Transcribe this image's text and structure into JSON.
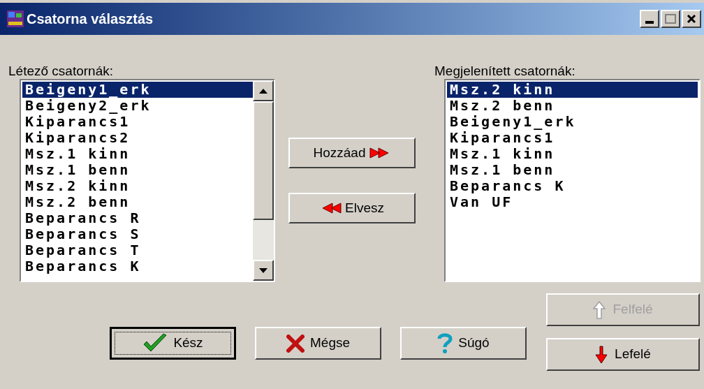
{
  "window": {
    "title": "Csatorna választás"
  },
  "available": {
    "label": "Létező csatornák:",
    "items": [
      {
        "text": "Beigeny1_erk",
        "selected": true
      },
      {
        "text": "Beigeny2_erk",
        "selected": false
      },
      {
        "text": "Kiparancs1",
        "selected": false
      },
      {
        "text": "Kiparancs2",
        "selected": false
      },
      {
        "text": "Msz.1 kinn",
        "selected": false
      },
      {
        "text": "Msz.1 benn",
        "selected": false
      },
      {
        "text": "Msz.2 kinn",
        "selected": false
      },
      {
        "text": "Msz.2 benn",
        "selected": false
      },
      {
        "text": "Beparancs R",
        "selected": false
      },
      {
        "text": "Beparancs S",
        "selected": false
      },
      {
        "text": "Beparancs T",
        "selected": false
      },
      {
        "text": "Beparancs K",
        "selected": false
      }
    ]
  },
  "displayed": {
    "label": "Megjelenített csatornák:",
    "items": [
      {
        "text": "Msz.2 kinn",
        "selected": true
      },
      {
        "text": "Msz.2 benn",
        "selected": false
      },
      {
        "text": "Beigeny1_erk",
        "selected": false
      },
      {
        "text": "Kiparancs1",
        "selected": false
      },
      {
        "text": "Msz.1 kinn",
        "selected": false
      },
      {
        "text": "Msz.1 benn",
        "selected": false
      },
      {
        "text": "Beparancs K",
        "selected": false
      },
      {
        "text": "Van UF",
        "selected": false
      }
    ]
  },
  "add_button": {
    "label": "Hozzáad"
  },
  "remove_button": {
    "label": "Elvesz"
  },
  "buttons": [
    {
      "kind": "ok",
      "label": "Kész",
      "default": true
    },
    {
      "kind": "cancel",
      "label": "Mégse",
      "default": false
    },
    {
      "kind": "help",
      "label": "Súgó",
      "default": false
    }
  ],
  "move_buttons": [
    {
      "kind": "up",
      "label": "Felfelé",
      "disabled": true
    },
    {
      "kind": "down",
      "label": "Lefelé",
      "disabled": false
    }
  ]
}
